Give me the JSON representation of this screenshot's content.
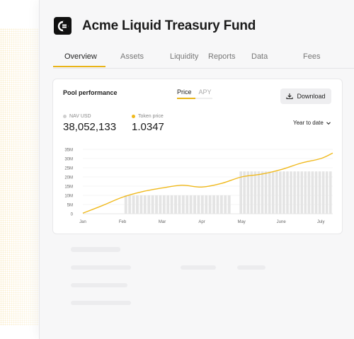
{
  "app": {
    "fund_name": "Acme Liquid Treasury Fund",
    "logo_icon": "fund-logo-icon"
  },
  "tabs": [
    {
      "label": "Overview",
      "active": true
    },
    {
      "label": "Assets",
      "active": false
    },
    {
      "label": "Liquidity",
      "active": false
    },
    {
      "label": "Reports",
      "active": false
    },
    {
      "label": "Data",
      "active": false
    },
    {
      "label": "Fees",
      "active": false
    }
  ],
  "performance": {
    "title": "Pool performance",
    "toggle": {
      "selected": "Price",
      "other": "APY"
    },
    "download_label": "Download",
    "period_label": "Year to date",
    "stats": [
      {
        "label": "NAV USD",
        "value": "38,052,133",
        "dot_color": "#cfcfcf"
      },
      {
        "label": "Token price",
        "value": "1.0347",
        "dot_color": "#f0b91c"
      }
    ]
  },
  "colors": {
    "accent": "#e9b418",
    "bar": "#e4e4e4"
  },
  "chart_data": {
    "type": "bar",
    "title": "",
    "xlabel": "",
    "ylabel": "",
    "ylim": [
      0,
      35
    ],
    "y_ticks": [
      "0",
      "5M",
      "10M",
      "15M",
      "20M",
      "25M",
      "30M",
      "35M"
    ],
    "x_tick_labels": [
      "Jan",
      "Feb",
      "Mar",
      "Apr",
      "May",
      "June",
      "July"
    ],
    "x_range": [
      0,
      6.3
    ],
    "grid": true,
    "bars": {
      "unit": "M",
      "segments": [
        {
          "start": 1.05,
          "end": 3.75,
          "value": 10
        },
        {
          "start": 3.95,
          "end": 6.3,
          "value": 23
        }
      ],
      "per_segment_count": [
        28,
        26
      ]
    },
    "series": [
      {
        "type": "line",
        "color": "#f0b91c",
        "x": [
          0,
          0.5,
          1.0,
          1.5,
          2.0,
          2.5,
          3.0,
          3.5,
          4.0,
          4.5,
          5.0,
          5.5,
          6.0,
          6.3
        ],
        "y": [
          0.3,
          4.5,
          9.0,
          12.0,
          14.0,
          15.5,
          14.5,
          16.5,
          20.0,
          21.5,
          24.0,
          27.5,
          30.0,
          33.0
        ]
      }
    ]
  }
}
